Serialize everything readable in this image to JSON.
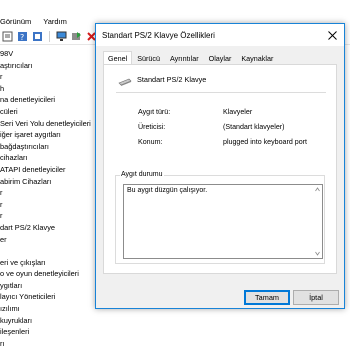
{
  "menu": {
    "items": [
      "Görünüm",
      "Yardım"
    ]
  },
  "tree": {
    "items": [
      "98V",
      "aştırıcıları",
      "r",
      "h",
      "na denetleyicileri",
      "cüleri",
      "Seri Veri Yolu denetleyicileri",
      "iğer işaret aygıtları",
      "bağdaştırıcıları",
      "cihazları",
      "ATAPI denetleyiciler",
      "abirim Cihazları",
      "r",
      "r",
      "r",
      "dart PS/2 Klavye",
      "er",
      "",
      "eri ve çıkışları",
      "o ve oyun denetleyicileri",
      "ygıtları",
      "layıcı Yöneticileri",
      "ızılımı",
      "kuyrukları",
      "ileşenleri",
      "rı"
    ]
  },
  "dialog": {
    "title": "Standart PS/2 Klavye Özellikleri",
    "tabs": [
      "Genel",
      "Sürücü",
      "Ayrıntılar",
      "Olaylar",
      "Kaynaklar"
    ],
    "device_name": "Standart PS/2 Klavye",
    "props": {
      "type_label": "Aygıt türü:",
      "type_value": "Klavyeler",
      "manufacturer_label": "Üreticisi:",
      "manufacturer_value": "(Standart klavyeler)",
      "location_label": "Konum:",
      "location_value": "plugged into keyboard port"
    },
    "status_group_title": "Aygıt durumu",
    "status_text": "Bu aygıt düzgün çalışıyor.",
    "ok_label": "Tamam",
    "cancel_label": "İptal"
  },
  "colors": {
    "accent": "#0078d7",
    "dialog_border": "#1883d7"
  }
}
